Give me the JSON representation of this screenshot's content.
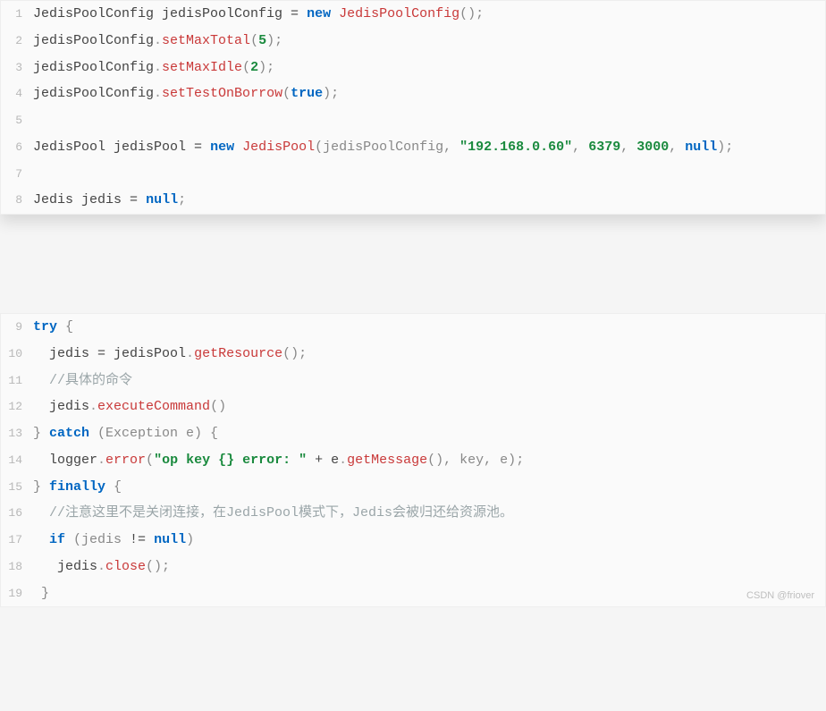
{
  "watermark": "CSDN @friover",
  "blocks": [
    {
      "lines": [
        {
          "n": "1",
          "tokens": [
            {
              "t": "JedisPoolConfig jedisPoolConfig ",
              "c": "plain"
            },
            {
              "t": "=",
              "c": "op"
            },
            {
              "t": " ",
              "c": "plain"
            },
            {
              "t": "new",
              "c": "kw"
            },
            {
              "t": " ",
              "c": "plain"
            },
            {
              "t": "JedisPoolConfig",
              "c": "method"
            },
            {
              "t": "();",
              "c": "paren"
            }
          ]
        },
        {
          "n": "2",
          "tokens": [
            {
              "t": "jedisPoolConfig",
              "c": "plain"
            },
            {
              "t": ".",
              "c": "dot"
            },
            {
              "t": "setMaxTotal",
              "c": "method"
            },
            {
              "t": "(",
              "c": "paren"
            },
            {
              "t": "5",
              "c": "num"
            },
            {
              "t": ");",
              "c": "paren"
            }
          ]
        },
        {
          "n": "3",
          "tokens": [
            {
              "t": "jedisPoolConfig",
              "c": "plain"
            },
            {
              "t": ".",
              "c": "dot"
            },
            {
              "t": "setMaxIdle",
              "c": "method"
            },
            {
              "t": "(",
              "c": "paren"
            },
            {
              "t": "2",
              "c": "num"
            },
            {
              "t": ");",
              "c": "paren"
            }
          ]
        },
        {
          "n": "4",
          "tokens": [
            {
              "t": "jedisPoolConfig",
              "c": "plain"
            },
            {
              "t": ".",
              "c": "dot"
            },
            {
              "t": "setTestOnBorrow",
              "c": "method"
            },
            {
              "t": "(",
              "c": "paren"
            },
            {
              "t": "true",
              "c": "bool"
            },
            {
              "t": ");",
              "c": "paren"
            }
          ]
        },
        {
          "n": "5",
          "tokens": []
        },
        {
          "n": "6",
          "tokens": [
            {
              "t": "JedisPool jedisPool ",
              "c": "plain"
            },
            {
              "t": "=",
              "c": "op"
            },
            {
              "t": " ",
              "c": "plain"
            },
            {
              "t": "new",
              "c": "kw"
            },
            {
              "t": " ",
              "c": "plain"
            },
            {
              "t": "JedisPool",
              "c": "method"
            },
            {
              "t": "(jedisPoolConfig, ",
              "c": "paren"
            },
            {
              "t": "\"192.168.0.60\"",
              "c": "str"
            },
            {
              "t": ", ",
              "c": "paren"
            },
            {
              "t": "6379",
              "c": "num"
            },
            {
              "t": ", ",
              "c": "paren"
            },
            {
              "t": "3000",
              "c": "num"
            },
            {
              "t": ", ",
              "c": "paren"
            },
            {
              "t": "null",
              "c": "nullkw"
            },
            {
              "t": ");",
              "c": "paren"
            }
          ]
        },
        {
          "n": "7",
          "tokens": []
        },
        {
          "n": "8",
          "tokens": [
            {
              "t": "Jedis jedis ",
              "c": "plain"
            },
            {
              "t": "=",
              "c": "op"
            },
            {
              "t": " ",
              "c": "plain"
            },
            {
              "t": "null",
              "c": "nullkw"
            },
            {
              "t": ";",
              "c": "paren"
            }
          ]
        }
      ]
    },
    {
      "lines": [
        {
          "n": "9",
          "tokens": [
            {
              "t": "try",
              "c": "kw"
            },
            {
              "t": " {",
              "c": "paren"
            }
          ]
        },
        {
          "n": "10",
          "tokens": [
            {
              "t": "  jedis ",
              "c": "plain"
            },
            {
              "t": "=",
              "c": "op"
            },
            {
              "t": " jedisPool",
              "c": "plain"
            },
            {
              "t": ".",
              "c": "dot"
            },
            {
              "t": "getResource",
              "c": "method"
            },
            {
              "t": "();",
              "c": "paren"
            }
          ]
        },
        {
          "n": "11",
          "tokens": [
            {
              "t": "  ",
              "c": "plain"
            },
            {
              "t": "//具体的命令",
              "c": "comment"
            }
          ]
        },
        {
          "n": "12",
          "tokens": [
            {
              "t": "  jedis",
              "c": "plain"
            },
            {
              "t": ".",
              "c": "dot"
            },
            {
              "t": "executeCommand",
              "c": "method"
            },
            {
              "t": "()",
              "c": "paren"
            }
          ]
        },
        {
          "n": "13",
          "tokens": [
            {
              "t": "} ",
              "c": "paren"
            },
            {
              "t": "catch",
              "c": "kw"
            },
            {
              "t": " (Exception e) {",
              "c": "paren"
            }
          ]
        },
        {
          "n": "14",
          "tokens": [
            {
              "t": "  logger",
              "c": "plain"
            },
            {
              "t": ".",
              "c": "dot"
            },
            {
              "t": "error",
              "c": "method"
            },
            {
              "t": "(",
              "c": "paren"
            },
            {
              "t": "\"op key {} error: \"",
              "c": "str"
            },
            {
              "t": " ",
              "c": "plain"
            },
            {
              "t": "+",
              "c": "op"
            },
            {
              "t": " e",
              "c": "plain"
            },
            {
              "t": ".",
              "c": "dot"
            },
            {
              "t": "getMessage",
              "c": "method"
            },
            {
              "t": "(), key, e);",
              "c": "paren"
            }
          ]
        },
        {
          "n": "15",
          "tokens": [
            {
              "t": "} ",
              "c": "paren"
            },
            {
              "t": "finally",
              "c": "kw"
            },
            {
              "t": " {",
              "c": "paren"
            }
          ]
        },
        {
          "n": "16",
          "tokens": [
            {
              "t": "  ",
              "c": "plain"
            },
            {
              "t": "//注意这里不是关闭连接，在JedisPool模式下，Jedis会被归还给资源池。",
              "c": "comment"
            }
          ]
        },
        {
          "n": "17",
          "tokens": [
            {
              "t": "  ",
              "c": "plain"
            },
            {
              "t": "if",
              "c": "kw"
            },
            {
              "t": " (jedis ",
              "c": "paren"
            },
            {
              "t": "!=",
              "c": "op"
            },
            {
              "t": " ",
              "c": "plain"
            },
            {
              "t": "null",
              "c": "nullkw"
            },
            {
              "t": ")",
              "c": "paren"
            }
          ]
        },
        {
          "n": "18",
          "tokens": [
            {
              "t": "   jedis",
              "c": "plain"
            },
            {
              "t": ".",
              "c": "dot"
            },
            {
              "t": "close",
              "c": "method"
            },
            {
              "t": "();",
              "c": "paren"
            }
          ]
        },
        {
          "n": "19",
          "tokens": [
            {
              "t": " }",
              "c": "paren"
            }
          ]
        }
      ]
    }
  ]
}
